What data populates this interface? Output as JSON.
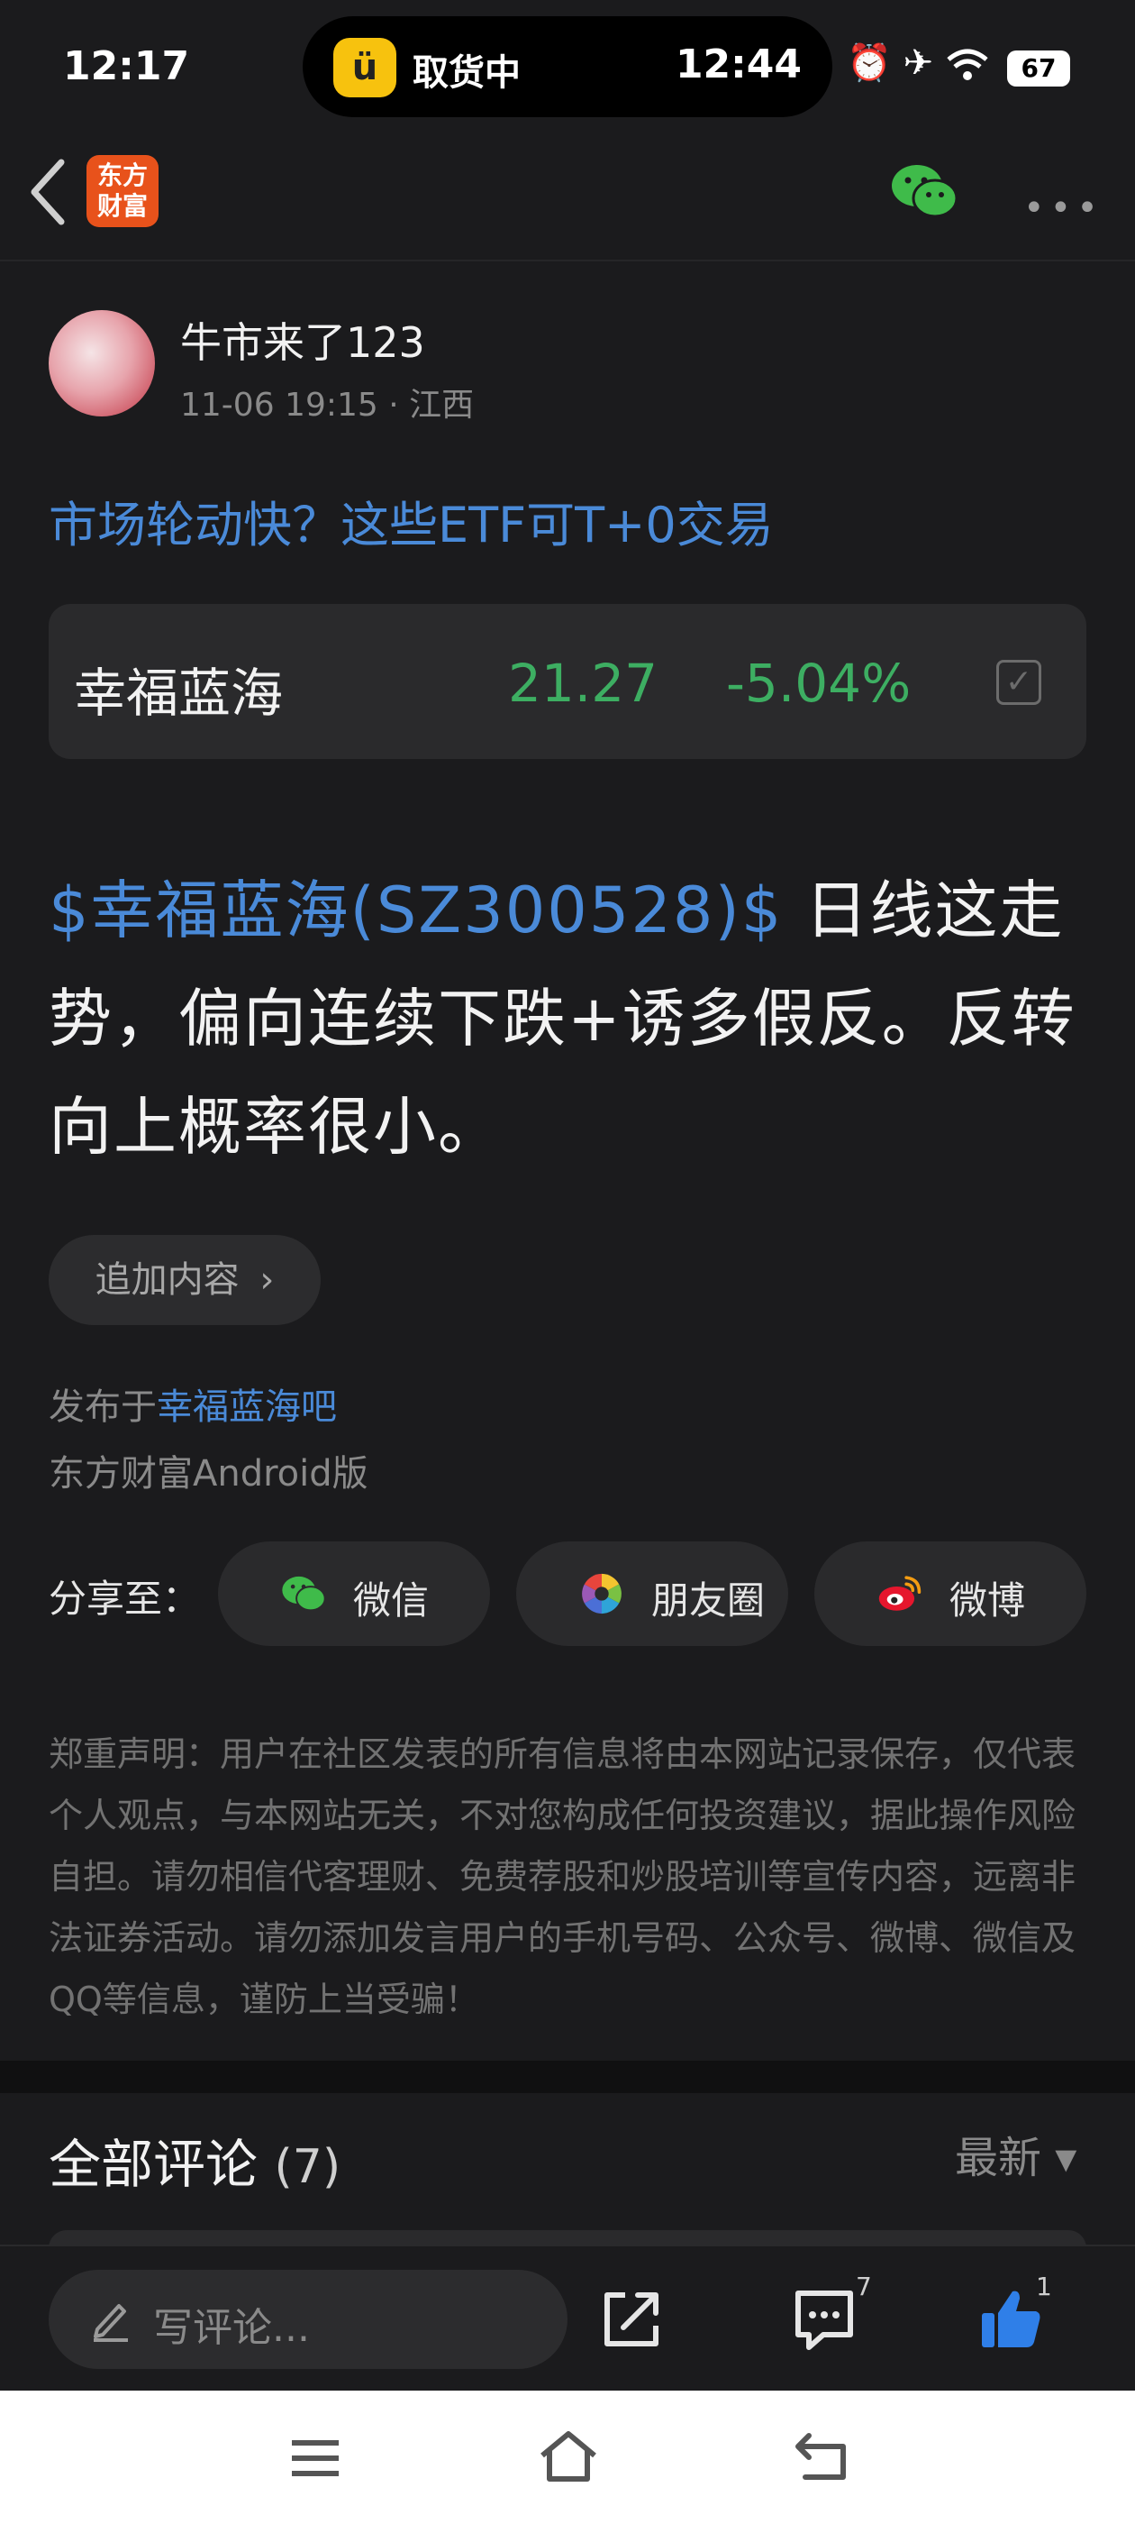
{
  "status_bar": {
    "time": "12:17",
    "island_label": "取货中",
    "island_time": "12:44",
    "icons": "⏰ ✈",
    "battery": "67"
  },
  "nav": {
    "logo_top": "东方",
    "logo_bottom": "财富"
  },
  "author": {
    "name": "牛市来了123",
    "date": "11-06 19:15",
    "location": "江西"
  },
  "post": {
    "title": "市场轮动快？这些ETF可T+0交易",
    "stock_link": "$幸福蓝海(SZ300528)$",
    "body": " 日线这走势，偏向连续下跌+诱多假反。反转向上概率很小。"
  },
  "stock_card": {
    "name": "幸福蓝海",
    "price": "21.27",
    "change": "-5.04%",
    "colors": {
      "down": "#3dae62"
    }
  },
  "actions": {
    "append_label": "追加内容",
    "append_chevron": "›"
  },
  "meta": {
    "published_prefix": "发布于",
    "forum": "幸福蓝海吧",
    "client": "东方财富Android版"
  },
  "share": {
    "label": "分享至：",
    "wechat": "微信",
    "moments": "朋友圈",
    "weibo": "微博"
  },
  "disclaimer": "郑重声明：用户在社区发表的所有信息将由本网站记录保存，仅代表个人观点，与本网站无关，不对您构成任何投资建议，据此操作风险自担。请勿相信代客理财、免费荐股和炒股培训等宣传内容，远离非法证券活动。请勿添加发言用户的手机号码、公众号、微博、微信及QQ等信息，谨防上当受骗！",
  "comments": {
    "title": "全部评论",
    "count": "(7)",
    "sort": "最新 ▾"
  },
  "bottom_bar": {
    "input_placeholder": "写评论...",
    "comment_count": "7",
    "like_count": "1",
    "like_color": "#2f7fe8"
  }
}
